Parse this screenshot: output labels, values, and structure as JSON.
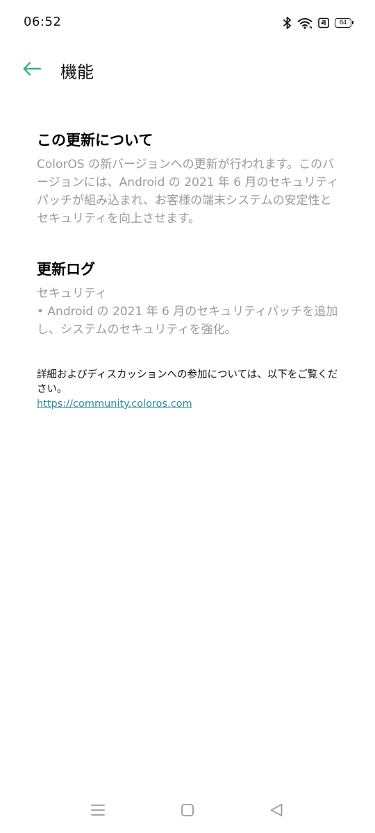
{
  "status_bar": {
    "time": "06:52",
    "battery": "84",
    "icons": [
      "bluetooth-icon",
      "wifi-icon",
      "nfc-icon",
      "battery-icon"
    ]
  },
  "app_bar": {
    "back_icon": "arrow-left-icon",
    "title": "機能"
  },
  "sections": {
    "about": {
      "heading": "この更新について",
      "body": "ColorOS の新バージョンへの更新が行われます。このバージョンには、Android の 2021 年 6 月のセキュリティパッチが組み込まれ、お客様の端末システムの安定性とセキュリティを向上させます。"
    },
    "changelog": {
      "heading": "更新ログ",
      "category": "セキュリティ",
      "item": "• Android の 2021 年 6 月のセキュリティパッチを追加し、システムのセキュリティを強化。"
    }
  },
  "more_info": {
    "text": "詳細およびディスカッションへの参加については、以下をご覧ください。",
    "link": "https://community.coloros.com"
  },
  "nav_bar": {
    "icons": [
      "menu-icon",
      "home-icon",
      "back-icon"
    ]
  },
  "colors": {
    "accent": "#2fb38a",
    "link": "#2b8a9a",
    "secondary_text": "#9a9a9a"
  }
}
